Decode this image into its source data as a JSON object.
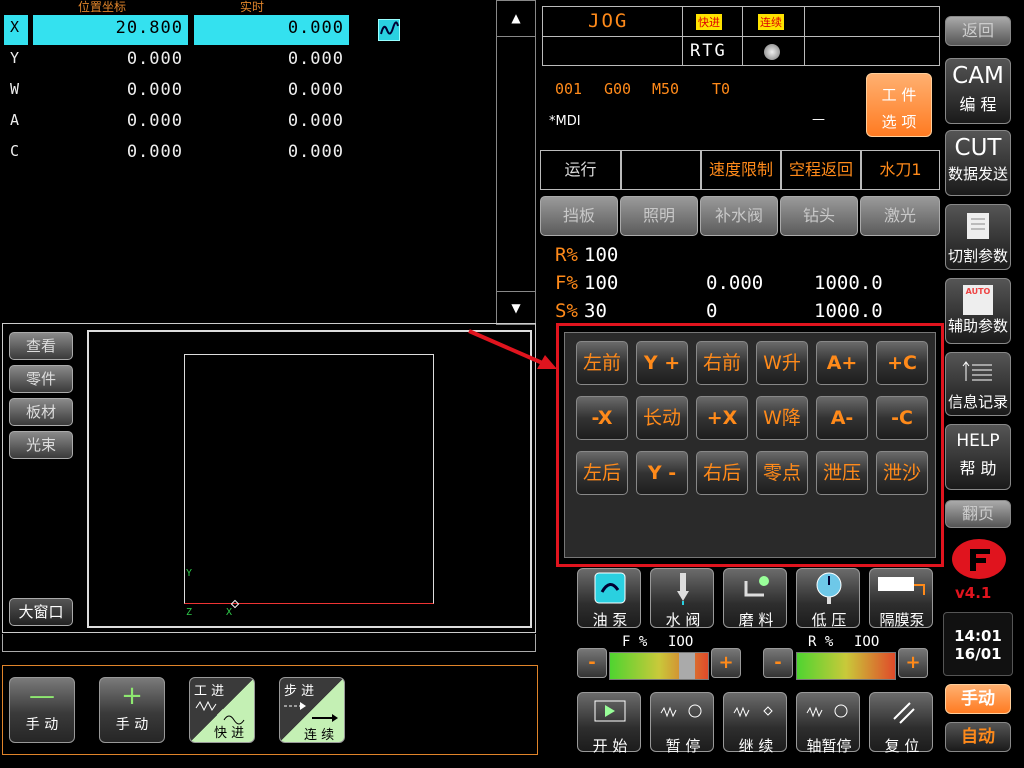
{
  "coords": {
    "header_pos": "位置坐标",
    "header_real": "实时",
    "rows": [
      {
        "axis": "X",
        "pos": "20.800",
        "real": "0.000"
      },
      {
        "axis": "Y",
        "pos": "0.000",
        "real": "0.000"
      },
      {
        "axis": "W",
        "pos": "0.000",
        "real": "0.000"
      },
      {
        "axis": "A",
        "pos": "0.000",
        "real": "0.000"
      },
      {
        "axis": "C",
        "pos": "0.000",
        "real": "0.000"
      }
    ]
  },
  "mode": {
    "jog": "JOG",
    "fast": "快进",
    "cont": "连续",
    "rtg": "RTG"
  },
  "codes": {
    "n": "001",
    "g": "G00",
    "m": "M50",
    "t": "T0",
    "mdi": "*MDI",
    "dash": "—"
  },
  "work_option": {
    "line1": "工 件",
    "line2": "选 项"
  },
  "status": [
    "运行",
    "",
    "速度限制",
    "空程返回",
    "水刀1"
  ],
  "disabled_btns": [
    "挡板",
    "照明",
    "补水阀",
    "钻头",
    "激光"
  ],
  "feed": {
    "r_label": "R%",
    "r_val": "100",
    "f_label": "F%",
    "f_val": "100",
    "f_pos": "0.000",
    "f_max": "1000.0",
    "s_label": "S%",
    "s_val": "30",
    "s_pos": "0",
    "s_max": "1000.0"
  },
  "jog_pad": [
    [
      "左前",
      "Y +",
      "右前",
      "W升",
      "A+",
      "+C"
    ],
    [
      "-X",
      "长动",
      "+X",
      "W降",
      "A-",
      "-C"
    ],
    [
      "左后",
      "Y -",
      "右后",
      "零点",
      "泄压",
      "泄沙"
    ]
  ],
  "func_buttons": [
    "油 泵",
    "水 阀",
    "磨 料",
    "低 压",
    "隔膜泵"
  ],
  "rate": {
    "f_label": "F %",
    "f_val": "IOO",
    "r_label": "R %",
    "r_val": "IOO",
    "f_pct": 0.87,
    "r_pct": 1.0
  },
  "action_buttons": [
    "开 始",
    "暂 停",
    "继 续",
    "轴暂停",
    "复 位"
  ],
  "right_menu": {
    "back": "返回",
    "cam_top": "CAM",
    "cam_bot": "编 程",
    "cut_top": "CUT",
    "cut_bot": "数据发送",
    "cut_param": "切割参数",
    "aux_param": "辅助参数",
    "aux_icon": "AUTO",
    "info": "信息记录",
    "help_top": "HELP",
    "help_bot": "帮 助",
    "page": "翻页",
    "version": "v4.1",
    "time": "14:01",
    "date": "16/01",
    "manual": "手动",
    "auto": "自动"
  },
  "side_tabs": [
    "查看",
    "零件",
    "板材",
    "光束"
  ],
  "big_window": "大窗口",
  "preview_axes": {
    "y": "Y",
    "z": "Z",
    "x": "X"
  },
  "bottom_btns": [
    {
      "sym": "—",
      "label": "手 动"
    },
    {
      "sym": "+",
      "label": "手 动"
    },
    {
      "top": "工 进",
      "bot": "快 进"
    },
    {
      "top": "步 进",
      "bot": "连 续"
    }
  ],
  "colors": {
    "accent": "#ff8a1a",
    "cyan": "#34e1ef",
    "highlight_red": "#e0141e"
  }
}
